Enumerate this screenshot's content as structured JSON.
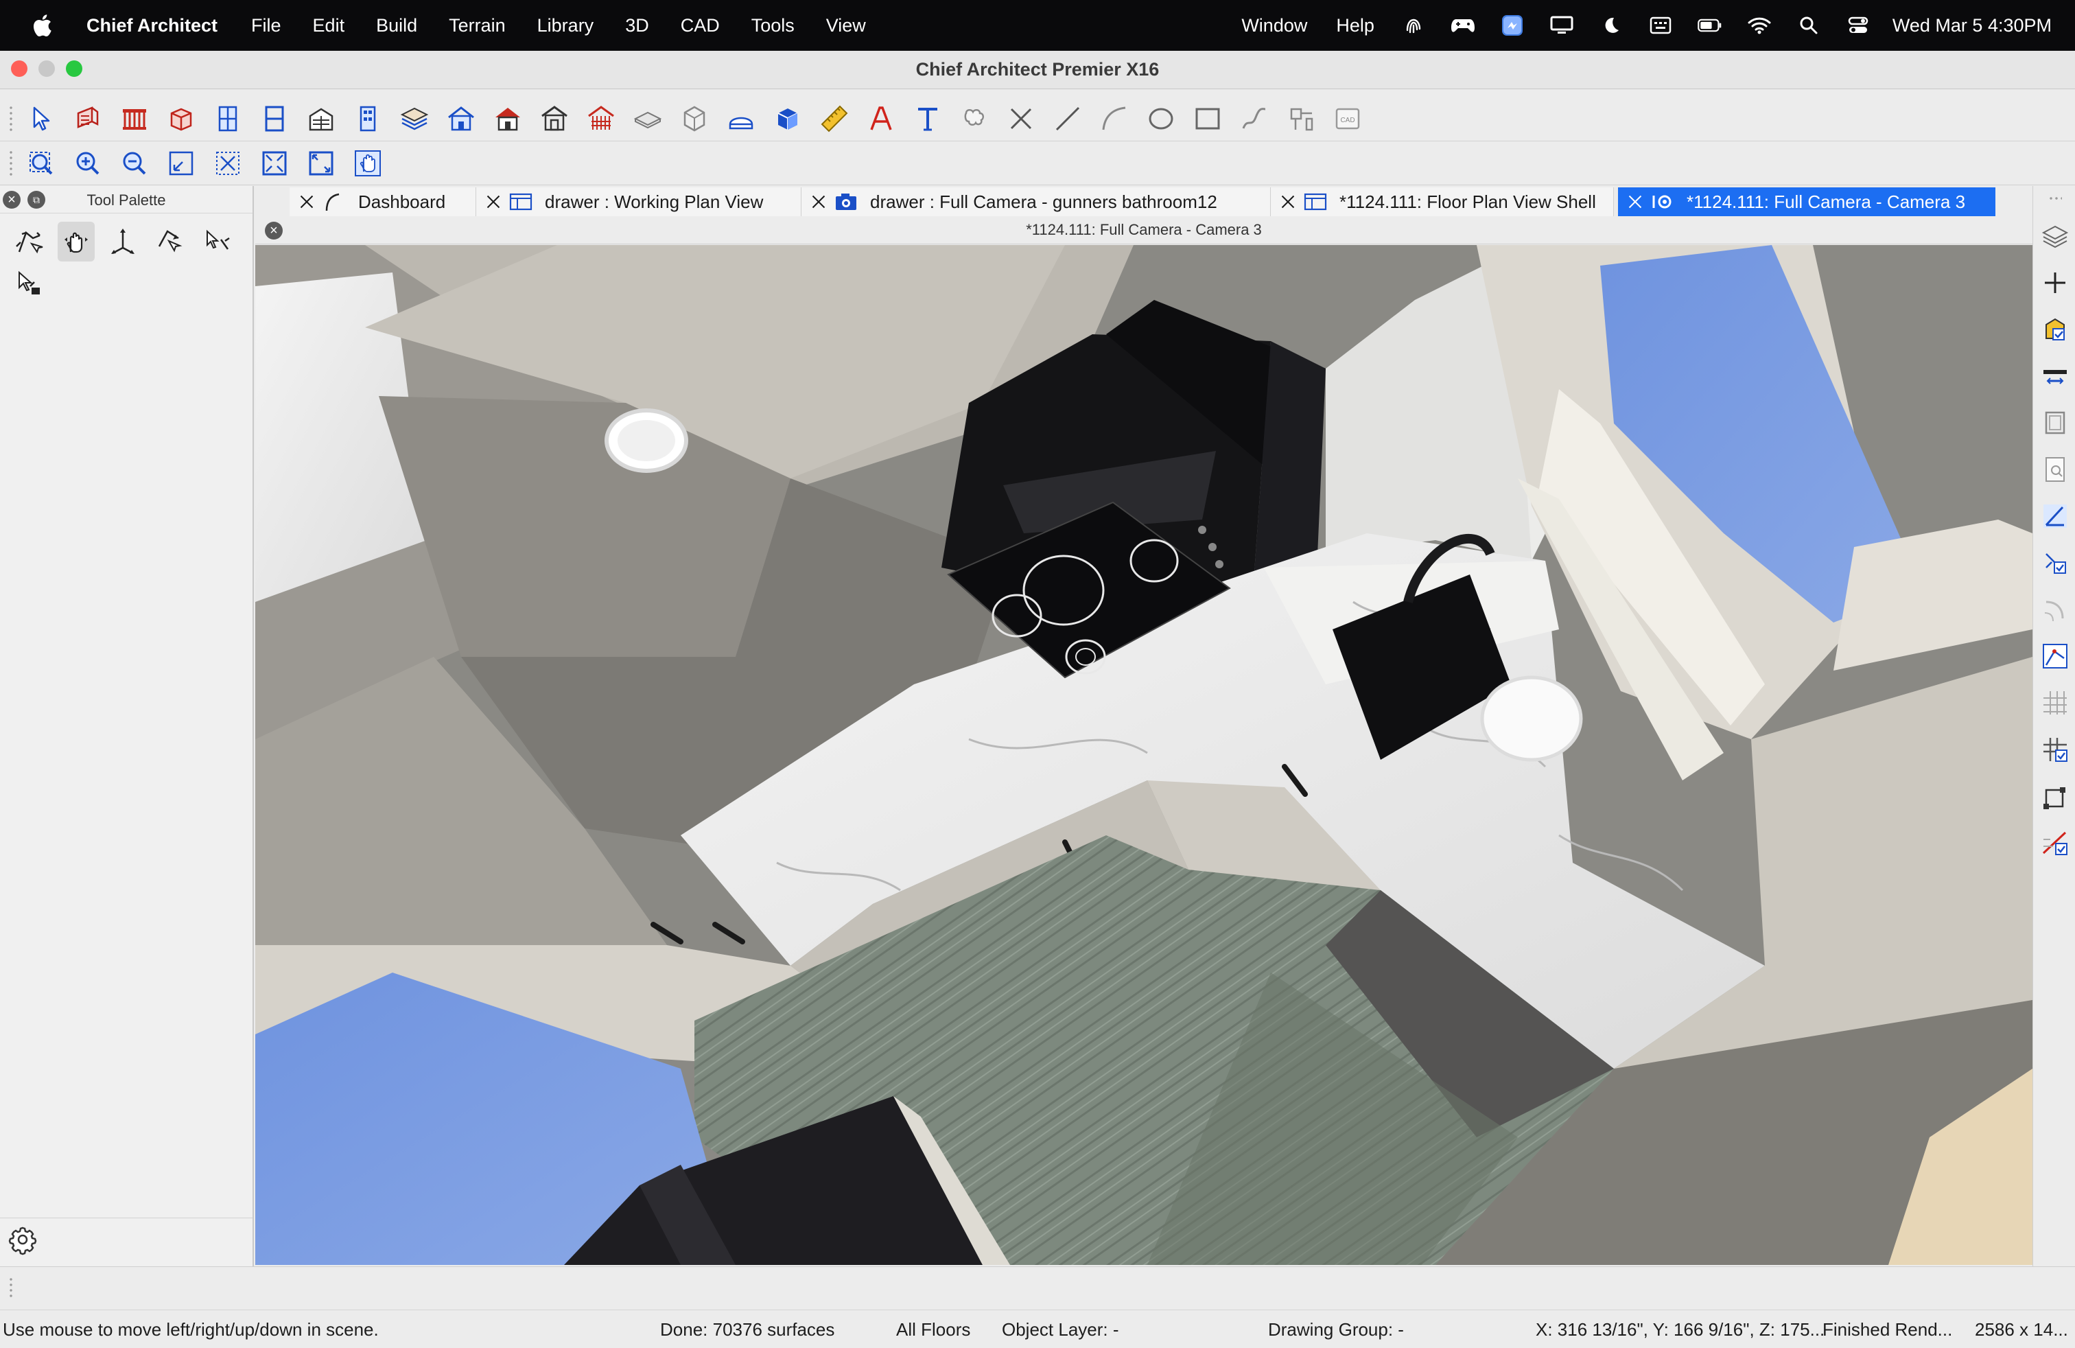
{
  "menubar": {
    "app_name": "Chief Architect",
    "items": [
      "File",
      "Edit",
      "Build",
      "Terrain",
      "Library",
      "3D",
      "CAD",
      "Tools",
      "View"
    ],
    "right_items": [
      "Window",
      "Help"
    ],
    "clock": "Wed Mar 5  4:30PM"
  },
  "window": {
    "title": "Chief Architect Premier X16"
  },
  "palette": {
    "title": "Tool Palette"
  },
  "tabs": [
    {
      "label": "Dashboard",
      "icon": "dashboard-arc-icon"
    },
    {
      "label": "drawer :  Working Plan View",
      "icon": "plan-view-icon"
    },
    {
      "label": "drawer : Full Camera - gunners bathroom12",
      "icon": "camera-icon"
    },
    {
      "label": "*1124.111: Floor Plan View Shell",
      "icon": "plan-view-icon"
    },
    {
      "label": "*1124.111: Full Camera - Camera 3",
      "icon": "camera-icon",
      "active": true
    }
  ],
  "view": {
    "title": "*1124.111: Full Camera - Camera 3"
  },
  "status": {
    "hint": "Use mouse to move left/right/up/down in scene.",
    "done": "Done:  70376 surfaces",
    "floors": "All Floors",
    "object_layer": "Object Layer: -",
    "drawing_group": "Drawing Group: -",
    "coords": "X: 316 13/16\", Y: 166 9/16\", Z: 175...",
    "render": "Finished Rend...",
    "size": "2586 x 14..."
  },
  "colors": {
    "accent": "#1c6ef2",
    "menubar": "#0a0a0c",
    "close": "#fe5f57",
    "minimize": "#c8c8c8",
    "zoom": "#28c840"
  }
}
